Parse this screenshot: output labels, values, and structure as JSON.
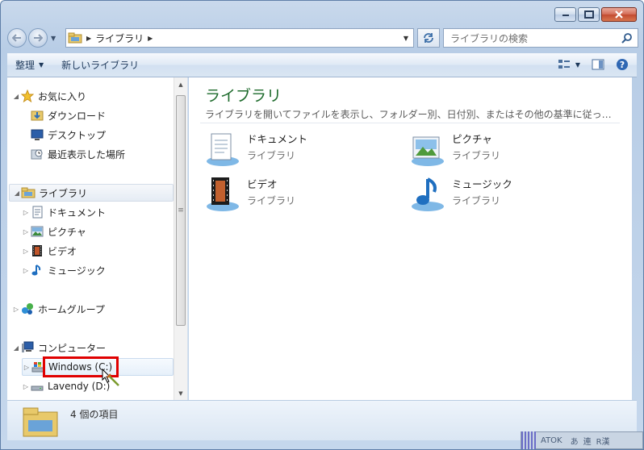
{
  "window": {
    "caption_buttons": [
      "minimize",
      "maximize",
      "close"
    ]
  },
  "address_bar": {
    "crumbs": [
      "ライブラリ"
    ],
    "search_placeholder": "ライブラリの検索"
  },
  "toolbar": {
    "organize_label": "整理",
    "new_library_label": "新しいライブラリ"
  },
  "nav": {
    "favorites": {
      "label": "お気に入り",
      "items": [
        {
          "label": "ダウンロード",
          "icon": "download-folder-icon"
        },
        {
          "label": "デスクトップ",
          "icon": "desktop-icon"
        },
        {
          "label": "最近表示した場所",
          "icon": "recent-places-icon"
        }
      ]
    },
    "libraries": {
      "label": "ライブラリ",
      "items": [
        {
          "label": "ドキュメント",
          "icon": "documents-icon"
        },
        {
          "label": "ピクチャ",
          "icon": "pictures-icon"
        },
        {
          "label": "ビデオ",
          "icon": "videos-icon"
        },
        {
          "label": "ミュージック",
          "icon": "music-icon"
        }
      ]
    },
    "homegroup": {
      "label": "ホームグループ"
    },
    "computer": {
      "label": "コンピューター",
      "items": [
        {
          "label": "Windows (C:)",
          "icon": "windows-drive-icon"
        },
        {
          "label": "Lavendy (D:)",
          "icon": "drive-icon"
        }
      ]
    }
  },
  "content": {
    "title": "ライブラリ",
    "description": "ライブラリを開いてファイルを表示し、フォルダー別、日付別、またはその他の基準に従っ…",
    "libraries": [
      {
        "name": "ドキュメント",
        "type": "ライブラリ",
        "icon": "documents-library-icon"
      },
      {
        "name": "ピクチャ",
        "type": "ライブラリ",
        "icon": "pictures-library-icon"
      },
      {
        "name": "ビデオ",
        "type": "ライブラリ",
        "icon": "videos-library-icon"
      },
      {
        "name": "ミュージック",
        "type": "ライブラリ",
        "icon": "music-library-icon"
      }
    ]
  },
  "details": {
    "item_count": "4 個の項目"
  },
  "ime_bar": {
    "brand": "ATOK",
    "mode": "あ",
    "speed": "連",
    "r_kanji": "R漢"
  },
  "colors": {
    "title_green": "#1e6b2c",
    "highlight_red": "#e00000",
    "accent_blue": "#1e395b"
  }
}
